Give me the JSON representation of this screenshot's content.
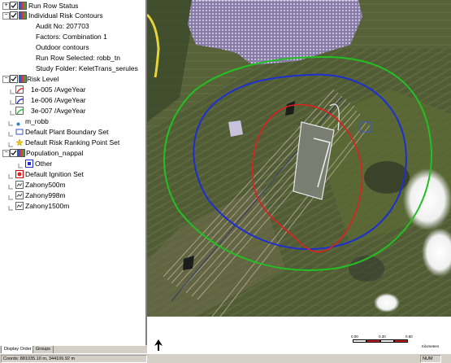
{
  "layers": [
    {
      "id": "run-row-status",
      "label": "Run Row Status",
      "expander": "+"
    },
    {
      "id": "individual-risk-contours",
      "label": "Individual Risk Contours",
      "expander": "−"
    },
    {
      "id": "audit-no",
      "label": "Audit No: 207703"
    },
    {
      "id": "factors",
      "label": "Factors: Combination 1"
    },
    {
      "id": "outdoor-contours",
      "label": "Outdoor contours"
    },
    {
      "id": "run-row-selected",
      "label": "Run Row Selected: robb_tn"
    },
    {
      "id": "study-folder",
      "label": "Study Folder: KeletTrans_serules"
    },
    {
      "id": "risk-level",
      "label": "Risk Level",
      "expander": "−"
    },
    {
      "id": "risk-1e-005",
      "label": "1e-005 /AvgeYear",
      "color": "#e02020"
    },
    {
      "id": "risk-1e-006",
      "label": "1e-006 /AvgeYear",
      "color": "#1e2fd0"
    },
    {
      "id": "risk-3e-007",
      "label": "3e-007 /AvgeYear",
      "color": "#22c022"
    },
    {
      "id": "m-robb",
      "label": "m_robb"
    },
    {
      "id": "default-plant-boundary-set",
      "label": "Default Plant Boundary Set"
    },
    {
      "id": "default-risk-ranking-point-set",
      "label": "Default Risk Ranking Point Set"
    },
    {
      "id": "population-nappal",
      "label": "Population_nappal",
      "expander": "−"
    },
    {
      "id": "other",
      "label": "Other"
    },
    {
      "id": "default-ignition-set",
      "label": "Default Ignition Set"
    },
    {
      "id": "zahony500m",
      "label": "Zahony500m"
    },
    {
      "id": "zahony998m",
      "label": "Zahony998m"
    },
    {
      "id": "zahony1500m",
      "label": "Zahony1500m"
    }
  ],
  "tabs": {
    "display_order": "Display Order",
    "groups": "Groups"
  },
  "status": {
    "coords": "Coords: 881035.10 m, 344106.92 m",
    "num": "NUM"
  },
  "scale_bar": {
    "t0": "0.00",
    "t1": "0.30",
    "t2": "0.60",
    "unit": "Kilometers"
  },
  "colors": {
    "contour_1e5": "#e02020",
    "contour_1e6": "#1e2fd0",
    "contour_3e7": "#22c022"
  }
}
